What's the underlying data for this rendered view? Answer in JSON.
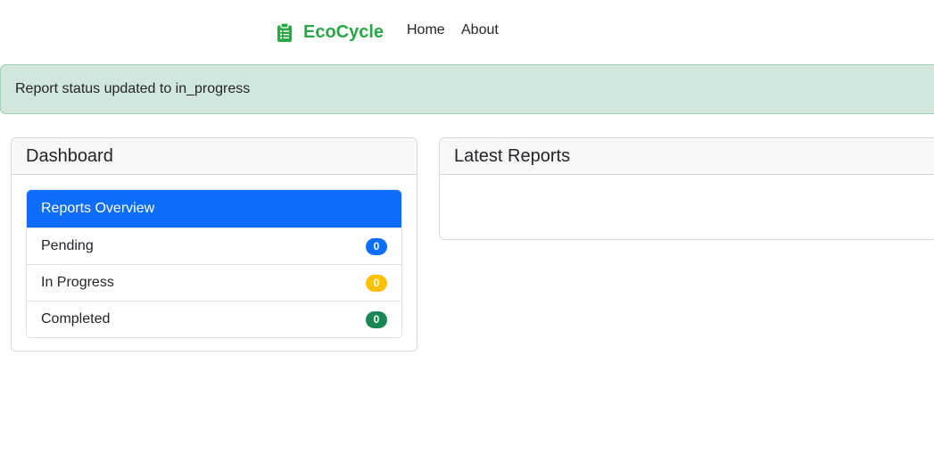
{
  "navbar": {
    "brand": "EcoCycle",
    "brand_icon": "clipboard-icon",
    "links": [
      "Home",
      "About"
    ]
  },
  "alert": {
    "message": "Report status updated to in_progress"
  },
  "dashboard": {
    "title": "Dashboard",
    "overview": {
      "title": "Reports Overview",
      "items": [
        {
          "label": "Pending",
          "count": "0",
          "color": "#0d6efd"
        },
        {
          "label": "In Progress",
          "count": "0",
          "color": "#ffc107"
        },
        {
          "label": "Completed",
          "count": "0",
          "color": "#198754"
        }
      ]
    }
  },
  "latest_reports": {
    "title": "Latest Reports"
  },
  "colors": {
    "brand": "#28a745",
    "alert_bg": "#d1e7dd",
    "primary": "#0d6efd"
  }
}
